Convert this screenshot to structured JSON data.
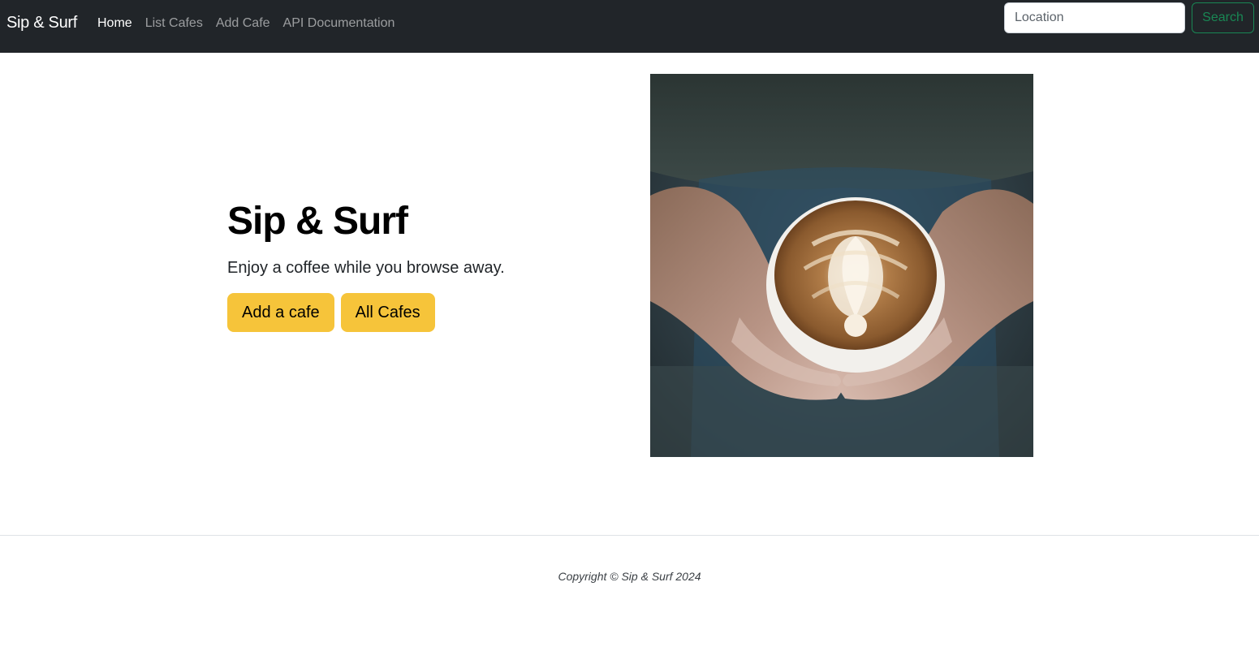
{
  "navbar": {
    "brand": "Sip & Surf",
    "links": [
      {
        "label": "Home",
        "active": true
      },
      {
        "label": "List Cafes",
        "active": false
      },
      {
        "label": "Add Cafe",
        "active": false
      },
      {
        "label": "API Documentation",
        "active": false
      }
    ],
    "search": {
      "placeholder": "Location",
      "value": "",
      "button_label": "Search"
    }
  },
  "hero": {
    "title": "Sip & Surf",
    "subtitle": "Enjoy a coffee while you browse away.",
    "buttons": [
      {
        "label": "Add a cafe"
      },
      {
        "label": "All Cafes"
      }
    ],
    "image_icon": "latte-art-photo"
  },
  "footer": {
    "copyright": "Copyright © Sip & Surf 2024"
  },
  "colors": {
    "navbar_bg": "#212529",
    "accent_warning": "#f6c43a",
    "search_success": "#198754"
  }
}
